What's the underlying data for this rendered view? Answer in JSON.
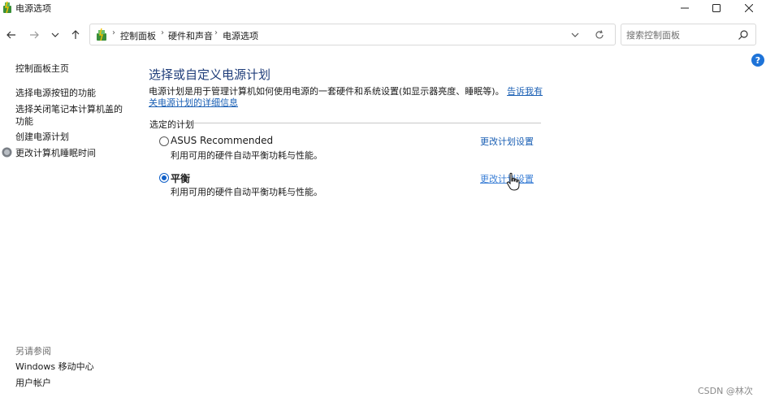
{
  "window": {
    "title": "电源选项",
    "minimize_icon": "minimize-icon",
    "maximize_icon": "maximize-icon",
    "close_icon": "close-icon"
  },
  "nav": {
    "breadcrumb": [
      "控制面板",
      "硬件和声音",
      "电源选项"
    ],
    "search_placeholder": "搜索控制面板"
  },
  "sidebar": {
    "links": [
      "控制面板主页",
      "选择电源按钮的功能",
      "选择关闭笔记本计算机盖的功能",
      "创建电源计划",
      "更改计算机睡眠时间"
    ],
    "see_also_heading": "另请参阅",
    "see_also_links": [
      "Windows 移动中心",
      "用户帐户"
    ]
  },
  "main": {
    "title": "选择或自定义电源计划",
    "description": "电源计划是用于管理计算机如何使用电源的一套硬件和系统设置(如显示器亮度、睡眠等)。",
    "description_link": "告诉我有关电源计划的详细信息",
    "group_label": "选定的计划",
    "plans": [
      {
        "name": "ASUS Recommended",
        "description": "利用可用的硬件自动平衡功耗与性能。",
        "link": "更改计划设置",
        "selected": false
      },
      {
        "name": "平衡",
        "description": "利用可用的硬件自动平衡功耗与性能。",
        "link": "更改计划设置",
        "selected": true
      }
    ]
  },
  "watermark": "CSDN @林次",
  "colors": {
    "accent": "#1060c8",
    "link": "#1a5fb4",
    "title": "#1f3d7a"
  }
}
